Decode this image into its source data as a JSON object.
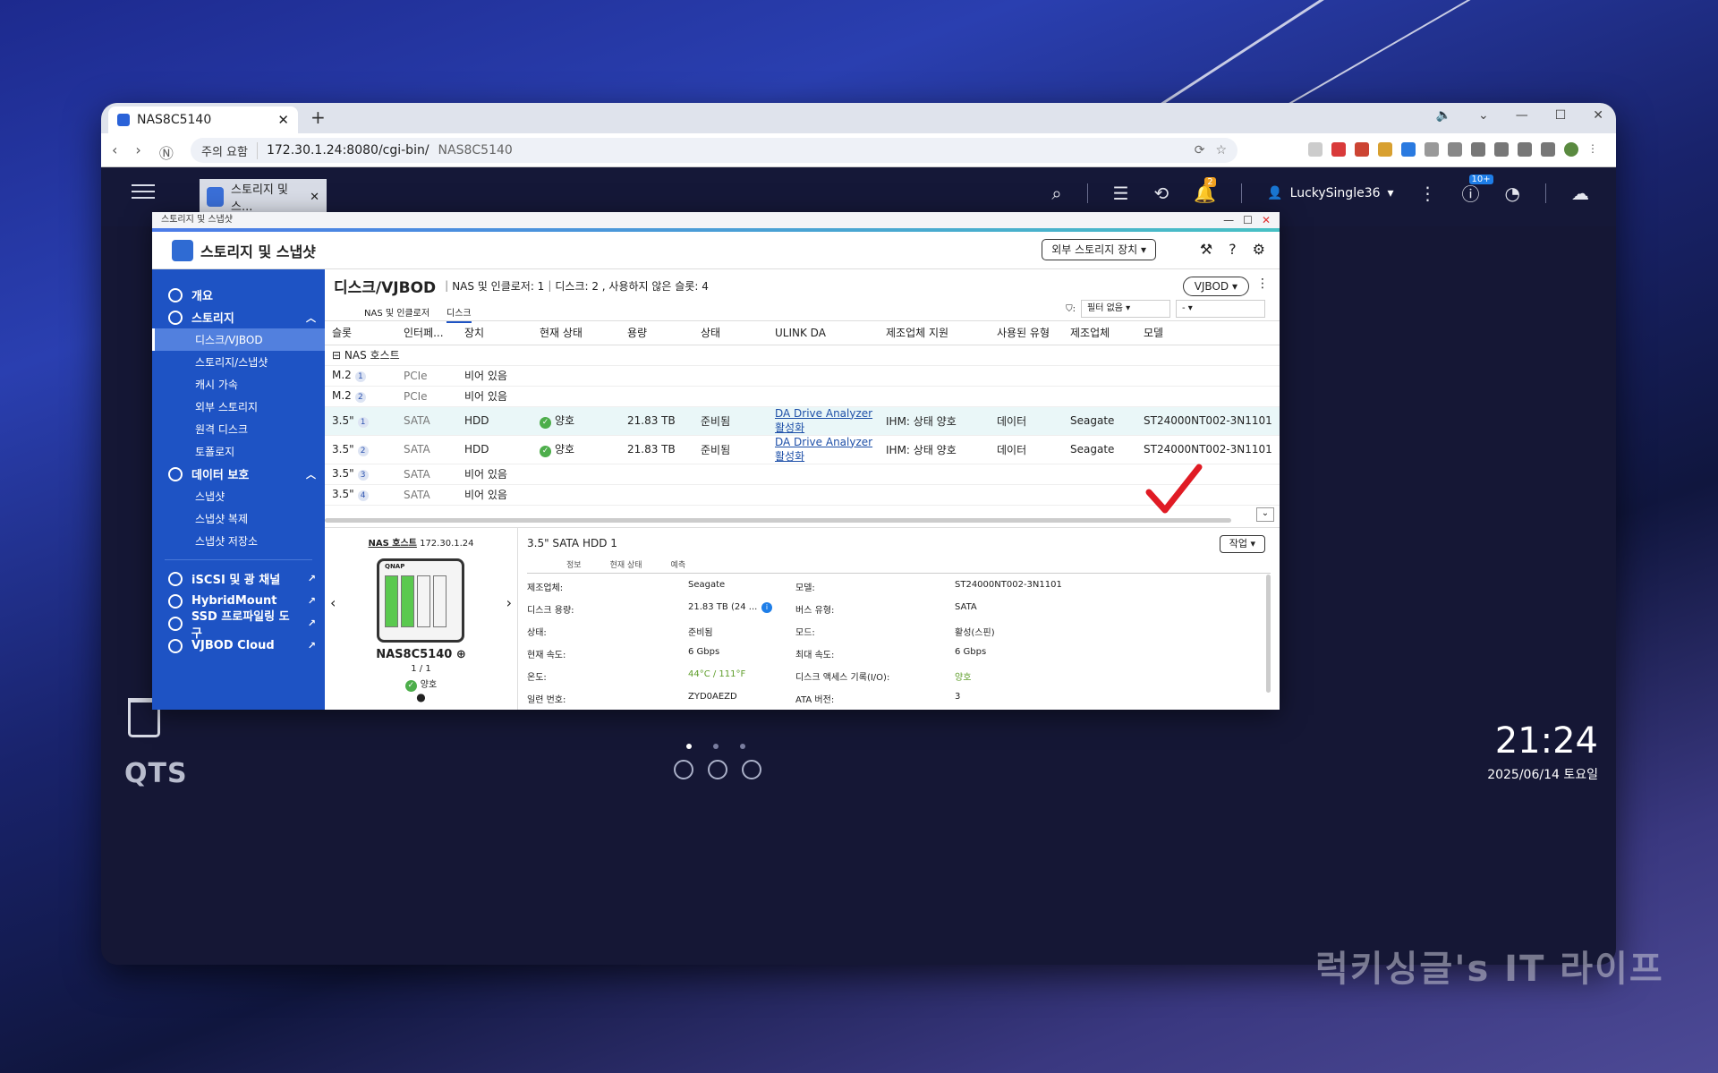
{
  "browser": {
    "tab_title": "NAS8C5140",
    "security_warning": "주의 요함",
    "url": "172.30.1.24:8080/cgi-bin/",
    "url_suffix": "NAS8C5140"
  },
  "qts": {
    "app_tab": "스토리지 및 스...",
    "user": "LuckySingle36",
    "notif_badge": "2",
    "update_badge": "10+",
    "brand": "QTS",
    "time": "21:24",
    "date": "2025/06/14 토요일"
  },
  "window": {
    "title": "스토리지 및 스냅샷",
    "app_title": "스토리지 및 스냅샷",
    "ext_storage_btn": "외부 스토리지 장치"
  },
  "sidebar": {
    "overview": "개요",
    "storage": "스토리지",
    "disks": "디스크/VJBOD",
    "storage_snap": "스토리지/스냅샷",
    "cache": "캐시 가속",
    "ext_storage": "외부 스토리지",
    "remote_disk": "원격 디스크",
    "topology": "토폴로지",
    "data_protect": "데이터 보호",
    "snapshot": "스냅샷",
    "snap_repl": "스냅샷 복제",
    "snap_vault": "스냅샷 저장소",
    "iscsi": "iSCSI 및 광 채널",
    "hybridmount": "HybridMount",
    "ssd": "SSD 프로파일링 도구",
    "vjbod_cloud": "VJBOD Cloud"
  },
  "main": {
    "title": "디스크/VJBOD",
    "summary1": "NAS 및 인클로저: 1",
    "summary2": "디스크: 2 , 사용하지 않은 슬롯: 4",
    "vjbod_btn": "VJBOD",
    "tab_nas": "NAS 및 인클로저",
    "tab_disk": "디스크",
    "filter_label": "필터 없음",
    "filter2": "-"
  },
  "table": {
    "headers": [
      "슬롯",
      "인터페...",
      "장치",
      "현재 상태",
      "용량",
      "상태",
      "ULINK DA",
      "제조업체 지원",
      "사용된 유형",
      "제조업체",
      "모델"
    ],
    "group": "NAS 호스트",
    "rows": [
      {
        "slot": "M.2",
        "num": "1",
        "iface": "PCIe",
        "device": "비어 있음",
        "status": "",
        "cap": "",
        "state": "",
        "ulink": "",
        "vendor_support": "",
        "used": "",
        "mfr": "",
        "model": ""
      },
      {
        "slot": "M.2",
        "num": "2",
        "iface": "PCIe",
        "device": "비어 있음",
        "status": "",
        "cap": "",
        "state": "",
        "ulink": "",
        "vendor_support": "",
        "used": "",
        "mfr": "",
        "model": ""
      },
      {
        "slot": "3.5\"",
        "num": "1",
        "iface": "SATA",
        "device": "HDD",
        "status": "양호",
        "cap": "21.83 TB",
        "state": "준비됨",
        "ulink": "DA Drive Analyzer 활성화",
        "vendor_support": "IHM: 상태 양호",
        "used": "데이터",
        "mfr": "Seagate",
        "model": "ST24000NT002-3N1101"
      },
      {
        "slot": "3.5\"",
        "num": "2",
        "iface": "SATA",
        "device": "HDD",
        "status": "양호",
        "cap": "21.83 TB",
        "state": "준비됨",
        "ulink": "DA Drive Analyzer 활성화",
        "vendor_support": "IHM: 상태 양호",
        "used": "데이터",
        "mfr": "Seagate",
        "model": "ST24000NT002-3N1101"
      },
      {
        "slot": "3.5\"",
        "num": "3",
        "iface": "SATA",
        "device": "비어 있음",
        "status": "",
        "cap": "",
        "state": "",
        "ulink": "",
        "vendor_support": "",
        "used": "",
        "mfr": "",
        "model": ""
      },
      {
        "slot": "3.5\"",
        "num": "4",
        "iface": "SATA",
        "device": "비어 있음",
        "status": "",
        "cap": "",
        "state": "",
        "ulink": "",
        "vendor_support": "",
        "used": "",
        "mfr": "",
        "model": ""
      }
    ]
  },
  "device": {
    "host_label": "NAS 호스트",
    "host_ip": "172.30.1.24",
    "logo": "QNAP",
    "name": "NAS8C5140",
    "count": "1 / 1",
    "status": "양호"
  },
  "detail": {
    "title": "3.5\" SATA HDD 1",
    "tab_info": "정보",
    "tab_status": "현재 상태",
    "tab_predict": "예측",
    "work_btn": "작업",
    "props": [
      {
        "k1": "제조업체:",
        "v1": "Seagate",
        "k2": "모델:",
        "v2": "ST24000NT002-3N1101"
      },
      {
        "k1": "디스크 용량:",
        "v1": "21.83 TB (24 ...",
        "k2": "버스 유형:",
        "v2": "SATA"
      },
      {
        "k1": "상태:",
        "v1": "준비됨",
        "k2": "모드:",
        "v2": "활성(스핀)"
      },
      {
        "k1": "현재 속도:",
        "v1": "6 Gbps",
        "k2": "최대 속도:",
        "v2": "6 Gbps"
      },
      {
        "k1": "온도:",
        "v1": "44°C / 111°F",
        "k2": "디스크 액세스 기록(I/O):",
        "v2": "양호"
      },
      {
        "k1": "일련 번호:",
        "v1": "ZYD0AEZD",
        "k2": "ATA 버전:",
        "v2": "3"
      }
    ]
  },
  "watermark": "럭키싱글's IT 라이프",
  "colors": {
    "sidebar": "#1e53c4",
    "ok": "#4dae4b",
    "link": "#1d4fa8",
    "check": "#e01b24"
  }
}
